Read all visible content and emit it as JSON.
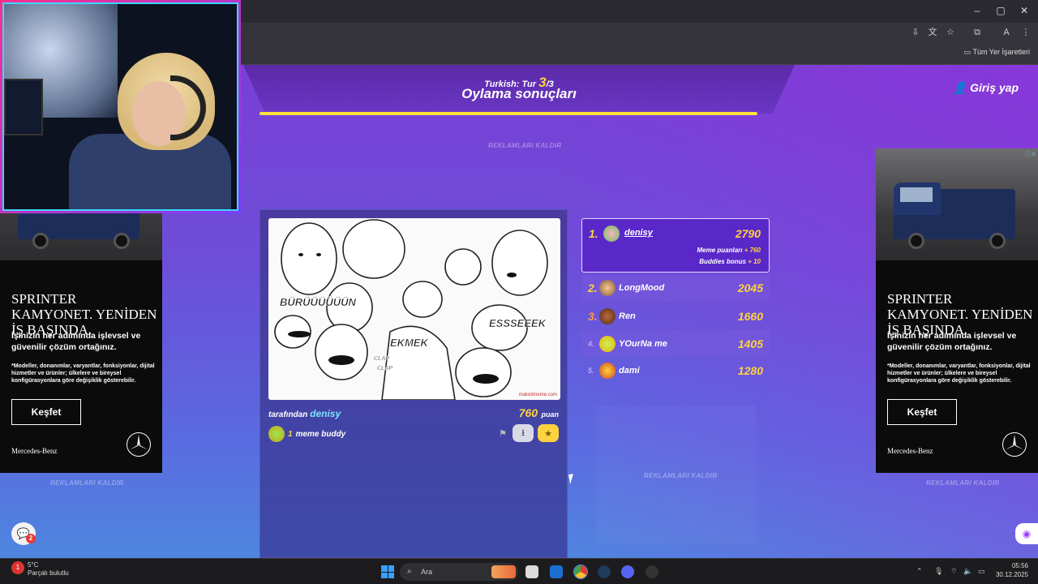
{
  "browser": {
    "bookmarks_label": "Tüm Yer İşaretleri",
    "profile_initial": "A"
  },
  "game": {
    "round_prefix": "Turkish: Tur",
    "round_current": "3",
    "round_total": "/3",
    "title": "Oylama sonuçları",
    "login_label": "Giriş yap",
    "remove_ads": "REKLAMLARI KALDIR",
    "timer_fraction": 0.96
  },
  "meme": {
    "labels": [
      "BÜRÜÜÜÜÜÜN",
      "EKMEK",
      "ESSSEEEK",
      "CLAP",
      "CLAP"
    ],
    "credit": "makeitmeme.com",
    "by_prefix": "tarafından",
    "author": "denisy",
    "points": "760",
    "points_unit": "puan",
    "buddy_count": "1",
    "buddy_label": "meme buddy"
  },
  "leaderboard": [
    {
      "rank": "1.",
      "name": "denisy",
      "score": "2790",
      "meme_points_label": "Meme puanları",
      "meme_points": "+ 760",
      "buddies_label": "Buddies bonus",
      "buddies": "+ 10"
    },
    {
      "rank": "2.",
      "name": "LongMood",
      "score": "2045"
    },
    {
      "rank": "3.",
      "name": "Ren",
      "score": "1660"
    },
    {
      "rank": "4.",
      "name": "YOurNa me",
      "score": "1405"
    },
    {
      "rank": "5.",
      "name": "dami",
      "score": "1280"
    }
  ],
  "ad": {
    "headline": "SPRINTER KAMYONET. YENİDEN İŞ BAŞINDA.",
    "subline": "İşinizin her adımında işlevsel ve güvenilir çözüm ortağınız.",
    "fine_print": "*Modeller, donanımlar, varyantlar, fonksiyonlar, dijital hizmetler ve ürünler; ülkelere ve bireysel konfigürasyonlara göre değişiklik gösterebilir.",
    "cta": "Keşfet",
    "brand": "Mercedes-Benz"
  },
  "chat": {
    "badge": "2"
  },
  "taskbar": {
    "weather_temp": "5°C",
    "weather_desc": "Parçalı bulutlu",
    "weather_badge": "1",
    "search_placeholder": "Ara",
    "time": "05:56",
    "date": "30.12.2025"
  }
}
